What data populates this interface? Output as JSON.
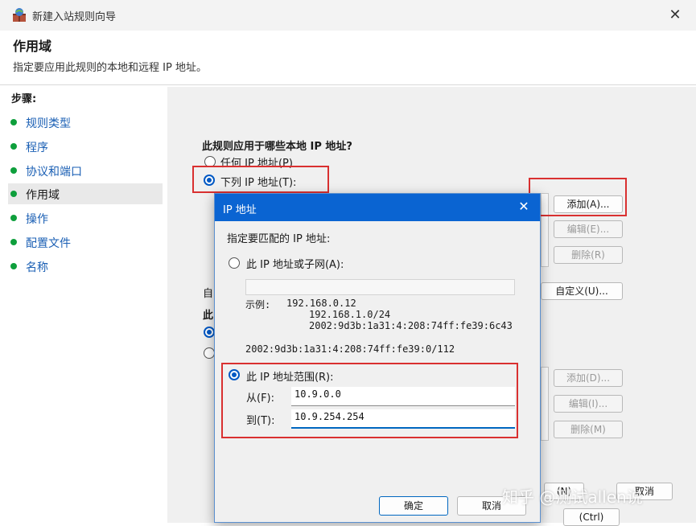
{
  "window": {
    "title": "新建入站规则向导",
    "close_glyph": "✕"
  },
  "header": {
    "title": "作用域",
    "description": "指定要应用此规则的本地和远程 IP 地址。"
  },
  "steps": {
    "heading": "步骤:",
    "items": [
      {
        "label": "规则类型"
      },
      {
        "label": "程序"
      },
      {
        "label": "协议和端口"
      },
      {
        "label": "作用域"
      },
      {
        "label": "操作"
      },
      {
        "label": "配置文件"
      },
      {
        "label": "名称"
      }
    ]
  },
  "local": {
    "question": "此规则应用于哪些本地 IP 地址?",
    "option_any": "任何 IP 地址(P)",
    "option_list": "下列 IP 地址(T):",
    "add_button": "添加(A)...",
    "edit_button": "编辑(E)...",
    "remove_button": "删除(R)"
  },
  "middle": {
    "partial_label_1": "自",
    "partial_label_2": "此",
    "customize_button": "自定义(U)..."
  },
  "remote": {
    "add_button": "添加(D)...",
    "edit_button": "编辑(I)...",
    "remove_button": "删除(M)"
  },
  "footer": {
    "partial_button_1": "(N)",
    "partial_button_2": "取消",
    "partial_button_3": "(Ctrl)"
  },
  "dialog": {
    "title": "IP 地址",
    "close_glyph": "✕",
    "prompt": "指定要匹配的 IP 地址:",
    "option_subnet": "此 IP 地址或子网(A):",
    "example_label": "示例:",
    "examples": [
      "192.168.0.12",
      "192.168.1.0/24",
      "2002:9d3b:1a31:4:208:74ff:fe39:6c43"
    ],
    "example_subnet": "2002:9d3b:1a31:4:208:74ff:fe39:0/112",
    "option_range": "此 IP 地址范围(R):",
    "from_label": "从(F):",
    "from_value": "10.9.0.0",
    "to_label": "到(T):",
    "to_value": "10.9.254.254",
    "ok_button": "确定",
    "cancel_button": "取消"
  },
  "watermark": "知乎 @测试allen说",
  "colors": {
    "accent": "#0a64d2",
    "step_link": "#1a5fb4",
    "bullet": "#0e9f3c",
    "highlight_box": "#d93030"
  }
}
